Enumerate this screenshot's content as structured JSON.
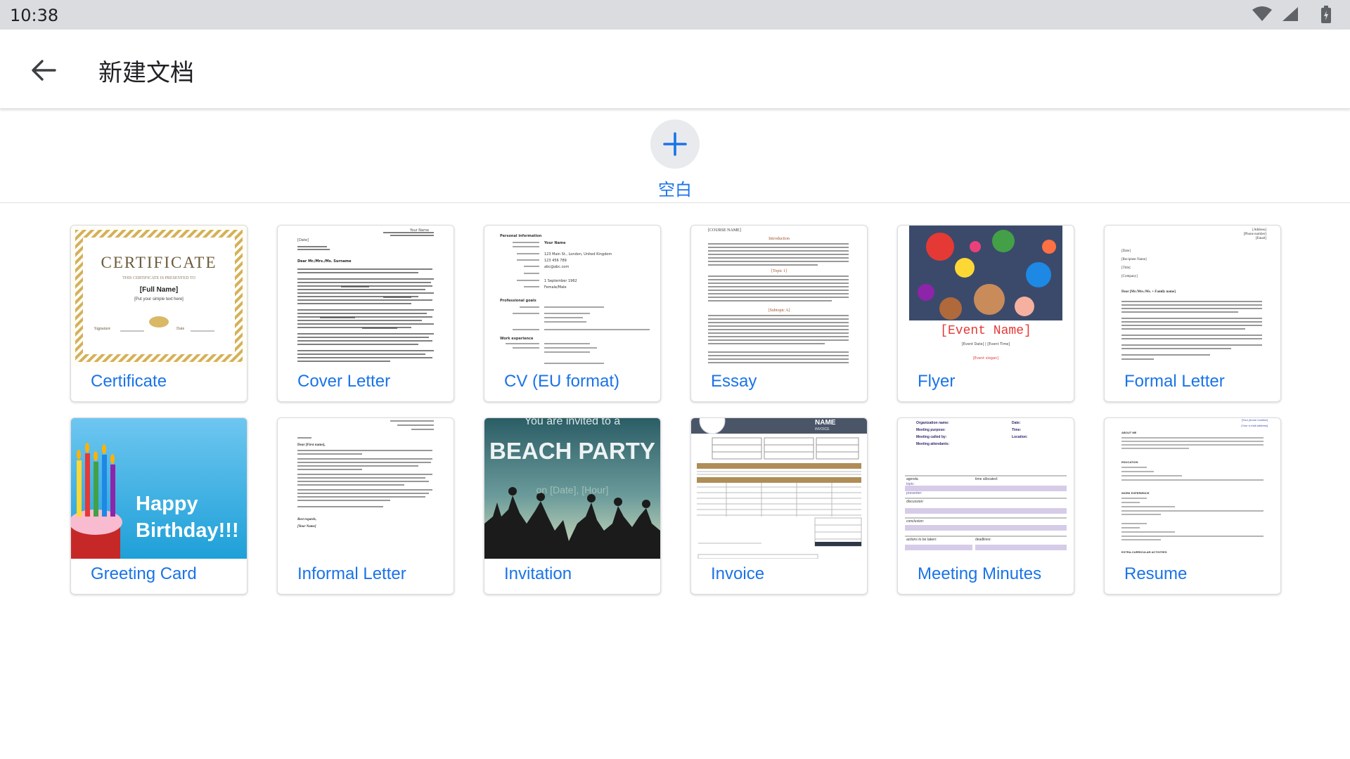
{
  "status_bar": {
    "time": "10:38",
    "icons": [
      "wifi-icon",
      "signal-icon",
      "battery-icon"
    ]
  },
  "app_bar": {
    "back_icon": "arrow-left-icon",
    "title": "新建文档"
  },
  "blank": {
    "icon": "plus-icon",
    "label": "空白"
  },
  "colors": {
    "accent": "#1a73e8",
    "status_bar_bg": "#dadce0",
    "card_border": "#dadce0"
  },
  "templates": [
    {
      "label": "Certificate",
      "thumb": {
        "heading": "CERTIFICATE",
        "subheading": "THIS CERTIFICATE IS PRESENTED TO",
        "name": "[Full Name]",
        "note": "[Put your simple text here]",
        "signature": "Signature",
        "date": "Date"
      }
    },
    {
      "label": "Cover Letter",
      "thumb": {
        "sender": "Your Name",
        "date": "[Date]",
        "greeting": "Dear Mr./Mrs./Ms. Surname"
      }
    },
    {
      "label": "CV (EU format)",
      "thumb": {
        "section": "Personal information",
        "name_field": "Your Name",
        "address": "123 Main St., London, United Kingdom",
        "phone": "123 456 789",
        "email": "abc@abc.com",
        "dob": "1 September 1962",
        "gender": "Female/Male",
        "section2": "Professional goals",
        "section3": "Work experience"
      }
    },
    {
      "label": "Essay",
      "thumb": {
        "course": "[COURSE NAME]",
        "intro": "Introduction",
        "topic1": "[Topic 1]",
        "subtopic": "[Subtopic A]"
      }
    },
    {
      "label": "Flyer",
      "thumb": {
        "event": "[Event Name]",
        "date_line": "[Event Date] | [Event Time]",
        "slogan": "[Event slogan]"
      }
    },
    {
      "label": "Formal Letter",
      "thumb": {
        "address": "[Address]",
        "phone": "[Phone number]",
        "email": "[Email]",
        "date": "[Date]",
        "recipient": "[Recipient Name]",
        "title_field": "[Title]",
        "company": "[Company]",
        "greeting": "Dear [Mr./Mrs./Ms. + Family name]"
      }
    },
    {
      "label": "Greeting Card",
      "thumb": {
        "line1": "Happy",
        "line2": "Birthday!!!"
      }
    },
    {
      "label": "Informal Letter",
      "thumb": {
        "greeting": "Dear [First name],",
        "closing": "Best regards,",
        "name": "[Your Name]"
      }
    },
    {
      "label": "Invitation",
      "thumb": {
        "line1": "You are invited to a",
        "line2": "BEACH PARTY",
        "line3": "on [Date], [Hour]"
      }
    },
    {
      "label": "Invoice",
      "thumb": {
        "name": "NAME",
        "subtitle": "INVOICE"
      }
    },
    {
      "label": "Meeting Minutes",
      "thumb": {
        "org": "Organization name:",
        "purpose": "Meeting purpose:",
        "called": "Meeting called by:",
        "attendants": "Meeting attendants:",
        "date": "Date:",
        "time": "Time:",
        "location": "Location:",
        "agenda": "agenda",
        "allocated": "time allocated:",
        "topic": "topic:",
        "presenter": "presenter:",
        "discussion": "discussion:",
        "conclusion": "conclusion:",
        "actions": "actions to be taken:",
        "deadlines": "deadlines:"
      }
    },
    {
      "label": "Resume",
      "thumb": {
        "phone": "[Your phone number]",
        "email": "[Your e-mail address]",
        "about": "ABOUT ME",
        "education": "EDUCATION",
        "work": "WORK EXPERIENCE",
        "extra": "EXTRA-CURRICULAR ACTIVITIES"
      }
    }
  ]
}
